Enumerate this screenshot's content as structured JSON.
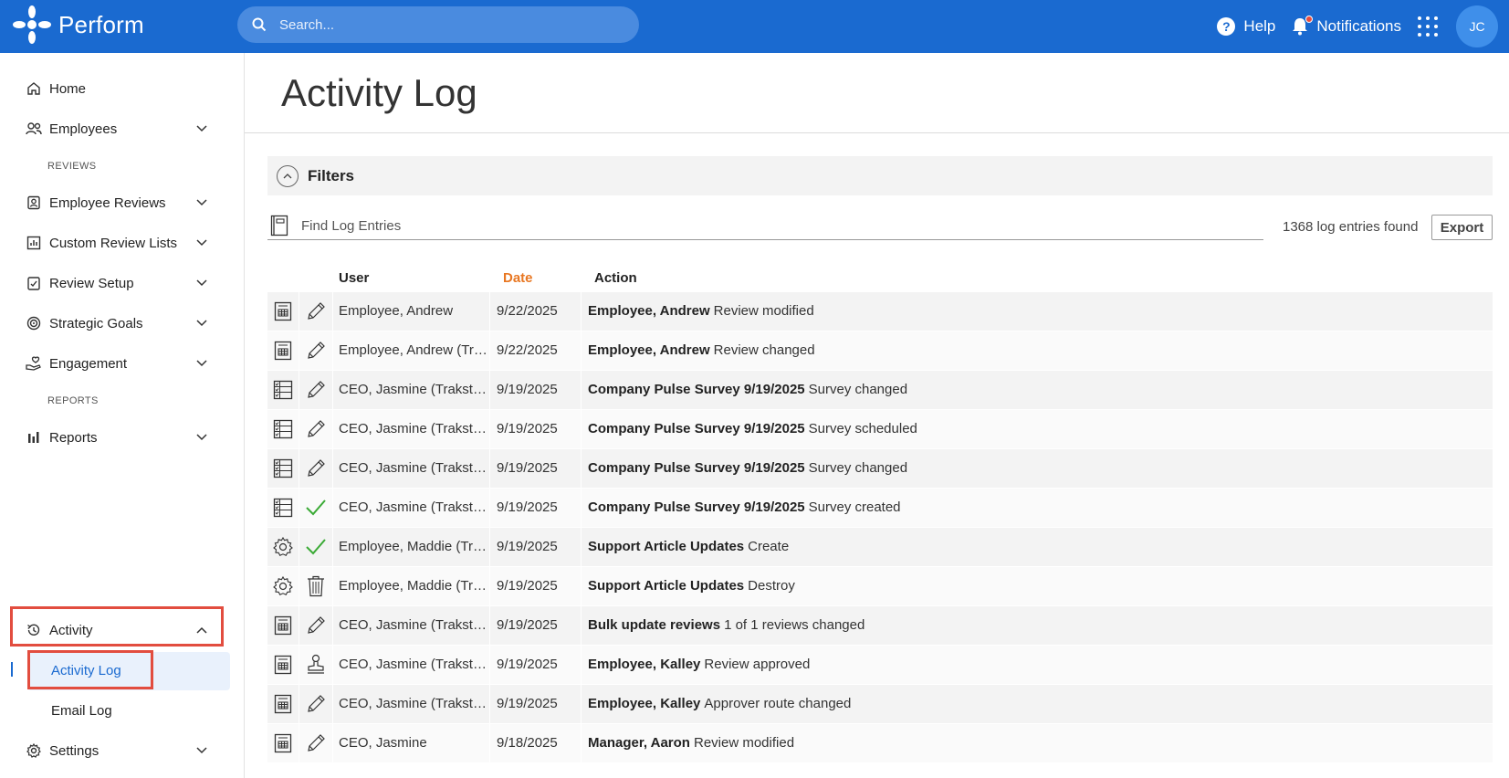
{
  "app": {
    "brand": "Perform"
  },
  "search": {
    "placeholder": "Search..."
  },
  "topbar": {
    "help_label": "Help",
    "notifications_label": "Notifications",
    "avatar_initials": "JC"
  },
  "sidebar": {
    "items": [
      {
        "label": "Home",
        "icon": "home-icon"
      },
      {
        "label": "Employees",
        "icon": "people-icon"
      },
      {
        "label": "Employee Reviews",
        "icon": "badge-icon"
      },
      {
        "label": "Custom Review Lists",
        "icon": "bar-chart-icon"
      },
      {
        "label": "Review Setup",
        "icon": "clipboard-icon"
      },
      {
        "label": "Strategic Goals",
        "icon": "target-icon"
      },
      {
        "label": "Engagement",
        "icon": "hand-heart-icon"
      },
      {
        "label": "Reports",
        "icon": "reports-icon"
      },
      {
        "label": "Activity",
        "icon": "history-icon"
      },
      {
        "label": "Settings",
        "icon": "gear-icon"
      }
    ],
    "sections": {
      "reviews": "REVIEWS",
      "reports": "REPORTS"
    },
    "activity_sub": {
      "activity_log": "Activity Log",
      "email_log": "Email Log"
    }
  },
  "main": {
    "title": "Activity Log",
    "filters_label": "Filters",
    "find_placeholder": "Find Log Entries",
    "count_text": "1368 log entries found",
    "export_label": "Export",
    "columns": {
      "user": "User",
      "date": "Date",
      "action": "Action"
    },
    "rows": [
      {
        "type_icon": "review-doc-icon",
        "action_icon": "pencil-icon",
        "user": "Employee, Andrew",
        "date": "9/22/2025",
        "subject": "Employee, Andrew",
        "action": "Review modified"
      },
      {
        "type_icon": "review-doc-icon",
        "action_icon": "pencil-icon",
        "user": "Employee, Andrew (Trakstar Support)",
        "date": "9/22/2025",
        "subject": "Employee, Andrew",
        "action": "Review changed"
      },
      {
        "type_icon": "survey-list-icon",
        "action_icon": "pencil-icon",
        "user": "CEO, Jasmine (Trakstar Support)",
        "date": "9/19/2025",
        "subject": "Company Pulse Survey 9/19/2025",
        "action": "Survey changed"
      },
      {
        "type_icon": "survey-list-icon",
        "action_icon": "pencil-icon",
        "user": "CEO, Jasmine (Trakstar Support)",
        "date": "9/19/2025",
        "subject": "Company Pulse Survey 9/19/2025",
        "action": "Survey scheduled"
      },
      {
        "type_icon": "survey-list-icon",
        "action_icon": "pencil-icon",
        "user": "CEO, Jasmine (Trakstar Support)",
        "date": "9/19/2025",
        "subject": "Company Pulse Survey 9/19/2025",
        "action": "Survey changed"
      },
      {
        "type_icon": "survey-list-icon",
        "action_icon": "checkmark-icon",
        "user": "CEO, Jasmine (Trakstar Support)",
        "date": "9/19/2025",
        "subject": "Company Pulse Survey 9/19/2025",
        "action": "Survey created"
      },
      {
        "type_icon": "gear-icon",
        "action_icon": "checkmark-icon",
        "user": "Employee, Maddie (Trakstar Support)",
        "date": "9/19/2025",
        "subject": "Support Article Updates",
        "action": "Create"
      },
      {
        "type_icon": "gear-icon",
        "action_icon": "trash-icon",
        "user": "Employee, Maddie (Trakstar Support)",
        "date": "9/19/2025",
        "subject": "Support Article Updates",
        "action": "Destroy"
      },
      {
        "type_icon": "review-doc-icon",
        "action_icon": "pencil-icon",
        "user": "CEO, Jasmine (Trakstar Support)",
        "date": "9/19/2025",
        "subject": "Bulk update reviews",
        "action": "1 of 1 reviews changed"
      },
      {
        "type_icon": "review-doc-icon",
        "action_icon": "stamp-icon",
        "user": "CEO, Jasmine (Trakstar Support)",
        "date": "9/19/2025",
        "subject": "Employee, Kalley",
        "action": "Review approved"
      },
      {
        "type_icon": "review-doc-icon",
        "action_icon": "pencil-icon",
        "user": "CEO, Jasmine (Trakstar Support)",
        "date": "9/19/2025",
        "subject": "Employee, Kalley",
        "action": "Approver route changed"
      },
      {
        "type_icon": "review-doc-icon",
        "action_icon": "pencil-icon",
        "user": "CEO, Jasmine",
        "date": "9/18/2025",
        "subject": "Manager, Aaron",
        "action": "Review modified"
      }
    ]
  },
  "colors": {
    "brand": "#1a6ad0",
    "accent": "#e87722",
    "highlight": "#e24d3f",
    "success": "#3aaa35"
  }
}
